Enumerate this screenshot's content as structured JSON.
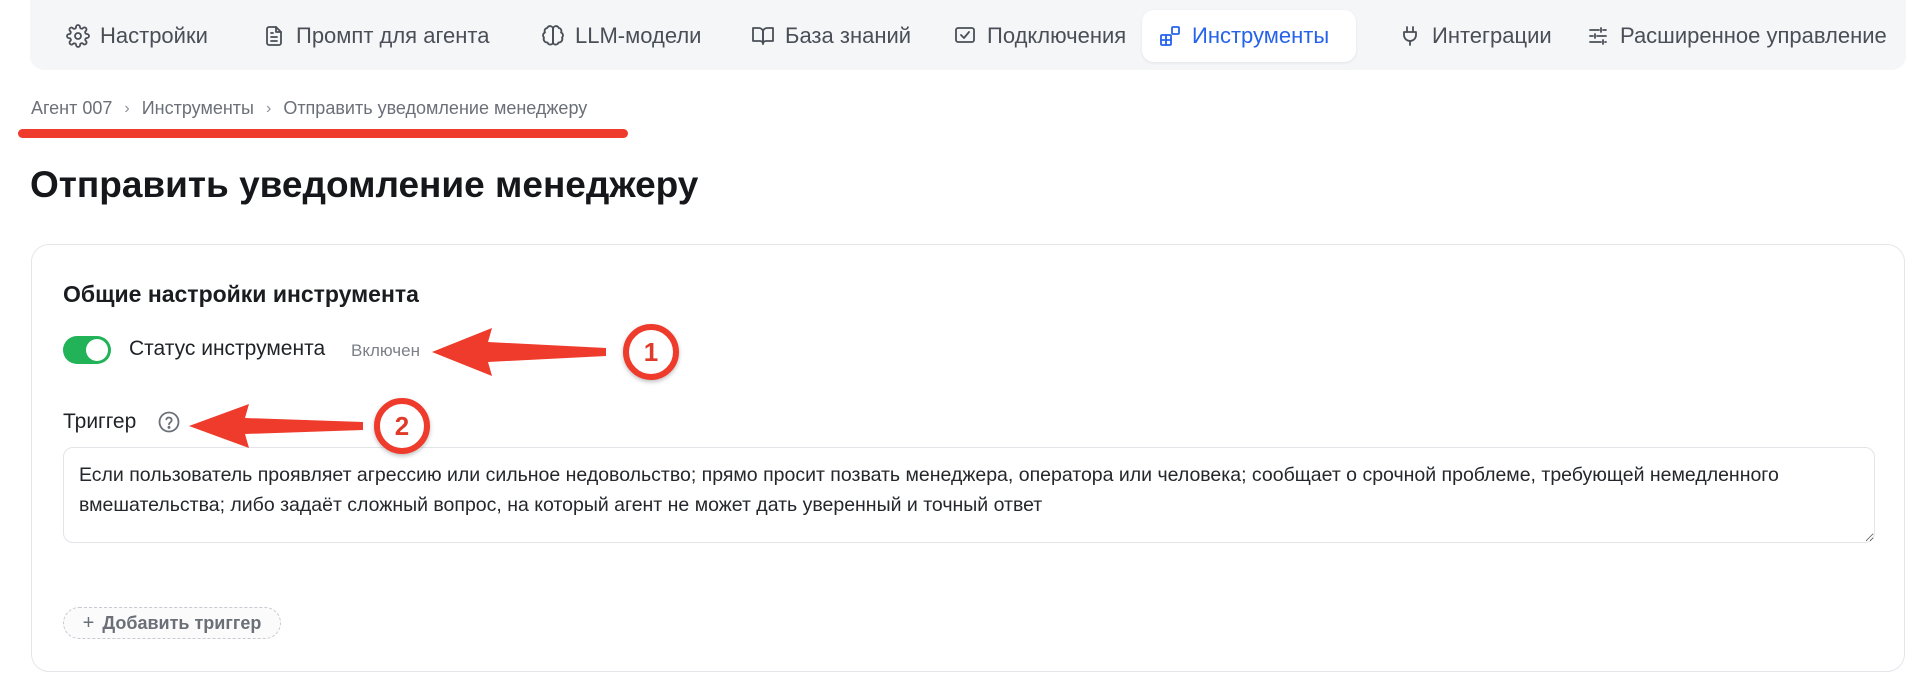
{
  "nav": {
    "items": [
      {
        "label": "Настройки",
        "icon": "gear-icon"
      },
      {
        "label": "Промпт для агента",
        "icon": "document-icon"
      },
      {
        "label": "LLM-модели",
        "icon": "brain-icon"
      },
      {
        "label": "База знаний",
        "icon": "book-icon"
      },
      {
        "label": "Подключения",
        "icon": "checkbox-window-icon"
      },
      {
        "label": "Инструменты",
        "icon": "blocks-icon",
        "active": true
      },
      {
        "label": "Интеграции",
        "icon": "plug-icon"
      },
      {
        "label": "Расширенное управление",
        "icon": "sliders-icon"
      }
    ],
    "active_color": "#2563eb"
  },
  "breadcrumb": {
    "items": [
      "Агент 007",
      "Инструменты",
      "Отправить уведомление менеджеру"
    ],
    "separator": "›"
  },
  "page": {
    "title": "Отправить уведомление менеджеру"
  },
  "card": {
    "title": "Общие настройки инструмента",
    "status": {
      "label": "Статус инструмента",
      "value": "Включен",
      "enabled": true,
      "toggle_color": "#22b258"
    },
    "trigger": {
      "label": "Триггер",
      "help_icon": "question-circle-icon",
      "value": "Если пользователь проявляет агрессию или сильное недовольство; прямо просит позвать менеджера, оператора или человека; сообщает о срочной проблеме, требующей немедленного вмешательства; либо задаёт сложный вопрос, на который агент не может дать уверенный и точный ответ"
    },
    "add_trigger": {
      "icon": "+",
      "label": "Добавить триггер"
    }
  },
  "annotations": {
    "color": "#ee3b2b",
    "badges": [
      "1",
      "2"
    ]
  }
}
